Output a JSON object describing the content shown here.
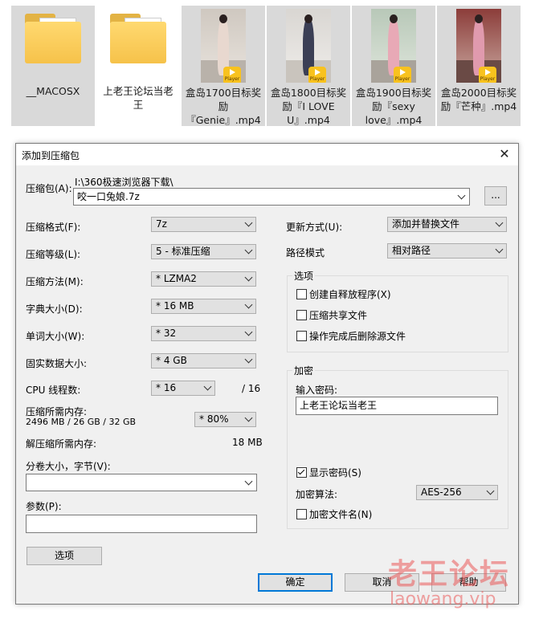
{
  "files": [
    {
      "name": "__MACOSX",
      "type": "folder",
      "selected": true
    },
    {
      "name": "上老王论坛当老王",
      "type": "folder",
      "selected": false
    },
    {
      "name": "盒岛1700目标奖励『Genie』.mp4",
      "type": "video",
      "selected": true
    },
    {
      "name": "盒岛1800目标奖励『I LOVE U』.mp4",
      "type": "video",
      "selected": true
    },
    {
      "name": "盒岛1900目标奖励『sexy love』.mp4",
      "type": "video",
      "selected": true
    },
    {
      "name": "盒岛2000目标奖励『芒种』.mp4",
      "type": "video",
      "selected": true
    }
  ],
  "player_badge": "Player",
  "dialog": {
    "title": "添加到压缩包",
    "close_glyph": "✕",
    "archive_label": "压缩包(A):",
    "archive_path": "I:\\360极速浏览器下载\\",
    "archive_name": "咬一口兔娘.7z",
    "browse_label": "...",
    "format_label": "压缩格式(F):",
    "format_value": "7z",
    "level_label": "压缩等级(L):",
    "level_value": "5 - 标准压缩",
    "method_label": "压缩方法(M):",
    "method_value": "* LZMA2",
    "dict_label": "字典大小(D):",
    "dict_value": "* 16 MB",
    "word_label": "单词大小(W):",
    "word_value": "* 32",
    "solid_label": "固实数据大小:",
    "solid_value": "* 4 GB",
    "cpu_label": "CPU 线程数:",
    "cpu_value": "* 16",
    "cpu_total": "/ 16",
    "mem_label": "压缩所需内存:",
    "mem_value": "2496 MB / 26 GB / 32 GB",
    "mem_percent": "* 80%",
    "decomp_label": "解压缩所需内存:",
    "decomp_value": "18 MB",
    "split_label": "分卷大小，字节(V):",
    "split_value": "",
    "params_label": "参数(P):",
    "params_value": "",
    "options_button": "选项",
    "update_label": "更新方式(U):",
    "update_value": "添加并替换文件",
    "path_label": "路径模式",
    "path_value": "相对路径",
    "options_group": "选项",
    "opt_sfx": "创建自释放程序(X)",
    "opt_shared": "压缩共享文件",
    "opt_delete": "操作完成后删除源文件",
    "encrypt_group": "加密",
    "password_label": "输入密码:",
    "password_value": "上老王论坛当老王",
    "show_password": "显示密码(S)",
    "encrypt_method_label": "加密算法:",
    "encrypt_method_value": "AES-256",
    "encrypt_names": "加密文件名(N)",
    "ok_button": "确定",
    "cancel_button": "取消",
    "help_button": "帮助"
  },
  "watermark": {
    "text": "老王论坛",
    "url": "laowang.vip"
  },
  "colors": {
    "accent": "#0078d7",
    "folder": "#f6c24a",
    "player": "#f8c21e",
    "selection": "#d9d9d9"
  }
}
